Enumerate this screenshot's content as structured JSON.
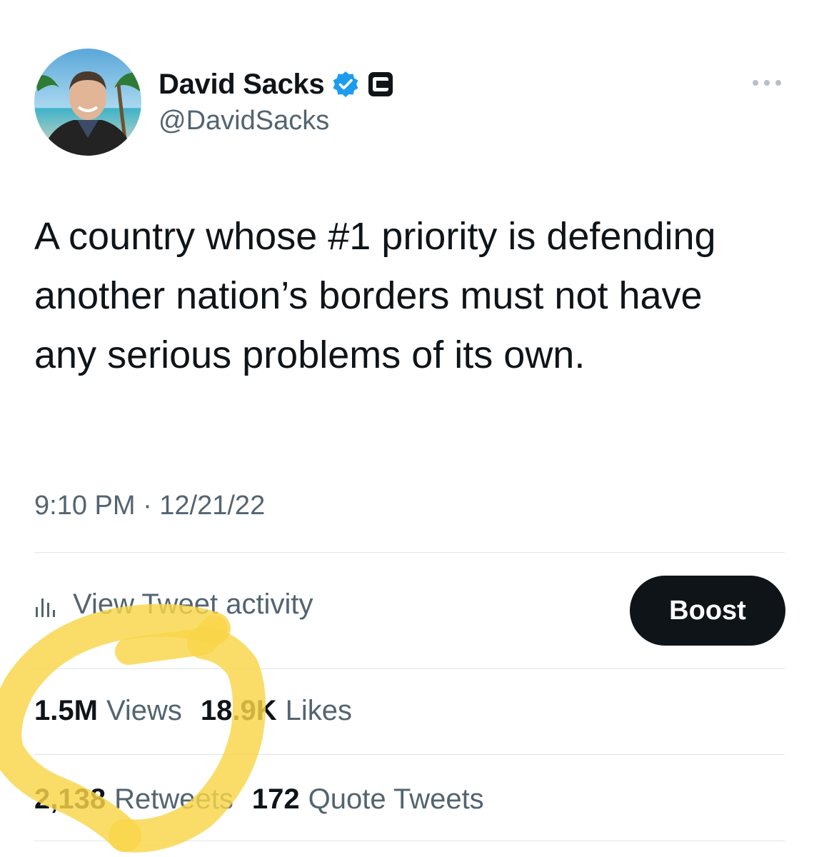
{
  "author": {
    "name": "David Sacks",
    "handle": "@DavidSacks",
    "avatar_icon": "profile-photo",
    "verified_icon": "verified-badge-icon",
    "affiliate_icon": "affiliate-c-badge-icon"
  },
  "tweet": {
    "text": "A country whose #1 priority is defending another nation’s borders must not have any serious problems of its own.",
    "timestamp": "9:10 PM · 12/21/22"
  },
  "actions": {
    "activity_label": "View Tweet activity",
    "boost_label": "Boost"
  },
  "stats": {
    "views_value": "1.5M",
    "views_label": "Views",
    "likes_value": "18.9K",
    "likes_label": "Likes",
    "retweets_value": "2,138",
    "retweets_label": "Retweets",
    "quotes_value": "172",
    "quotes_label": "Quote Tweets"
  },
  "colors": {
    "text_primary": "#0f1419",
    "text_secondary": "#536471",
    "verified_blue": "#1d9bf0",
    "highlight_yellow": "#f9d648",
    "boost_bg": "#0f1419"
  }
}
